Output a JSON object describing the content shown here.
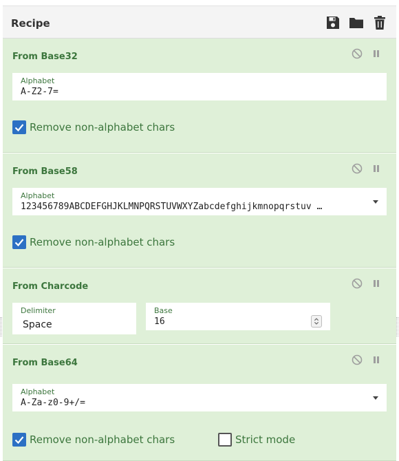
{
  "header": {
    "title": "Recipe"
  },
  "operations": [
    {
      "title": "From Base32",
      "alphabet_label": "Alphabet",
      "alphabet_value": "A-Z2-7=",
      "remove_label": "Remove non-alphabet chars",
      "remove_checked": true
    },
    {
      "title": "From Base58",
      "alphabet_label": "Alphabet",
      "alphabet_value": "123456789ABCDEFGHJKLMNPQRSTUVWXYZabcdefghijkmnopqrstuv …",
      "remove_label": "Remove non-alphabet chars",
      "remove_checked": true
    },
    {
      "title": "From Charcode",
      "delimiter_label": "Delimiter",
      "delimiter_value": "Space",
      "base_label": "Base",
      "base_value": "16"
    },
    {
      "title": "From Base64",
      "alphabet_label": "Alphabet",
      "alphabet_value": "A-Za-z0-9+/=",
      "remove_label": "Remove non-alphabet chars",
      "remove_checked": true,
      "strict_label": "Strict mode",
      "strict_checked": false
    }
  ],
  "icons": {
    "save": "save-icon",
    "load": "folder-icon",
    "clear": "trash-icon",
    "disable": "disable-icon",
    "breakpoint": "pause-icon"
  },
  "colors": {
    "op_background": "#dff0d8",
    "op_text": "#3c763d",
    "checkbox_on": "#2c70c4",
    "icon_dark": "#333333",
    "icon_muted": "#9e9e9e"
  }
}
